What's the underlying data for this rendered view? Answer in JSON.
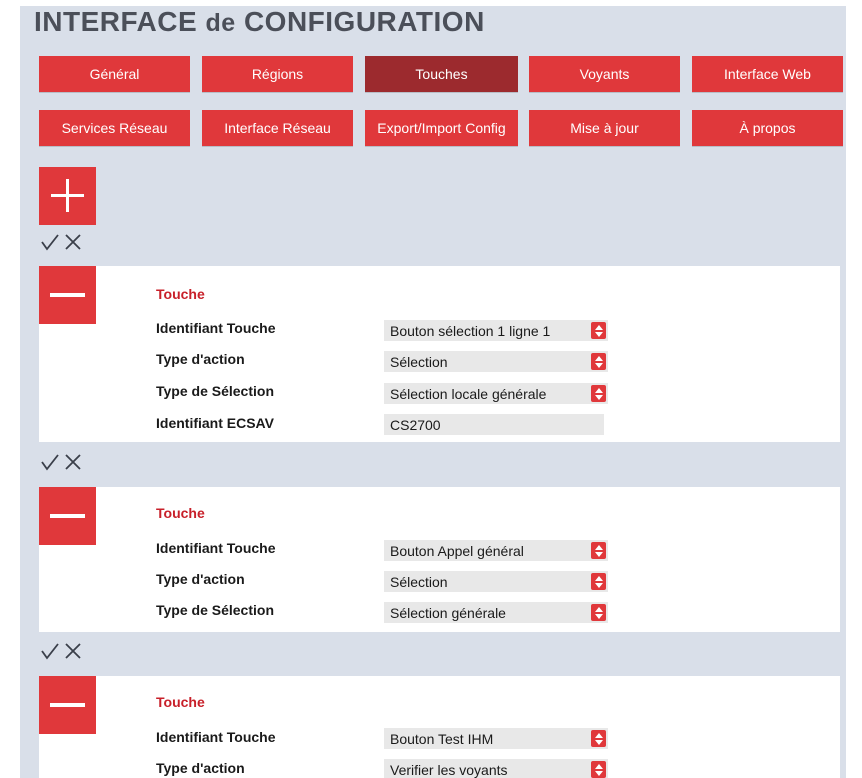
{
  "page": {
    "title_main": "INTERFACE",
    "title_de": "de",
    "title_end": "CONFIGURATION"
  },
  "nav": {
    "row1": [
      "Général",
      "Régions",
      "Touches",
      "Voyants",
      "Interface Web"
    ],
    "row2": [
      "Services Réseau",
      "Interface Réseau",
      "Export/Import Config",
      "Mise à jour",
      "À propos"
    ],
    "active": "Touches"
  },
  "colors": {
    "accent": "#e0383b",
    "accent_active": "#9c2a2e",
    "panel_bg": "#d9dfe9",
    "title_red": "#c8202a"
  },
  "icons": {
    "add": "plus-icon",
    "remove": "minus-icon",
    "confirm": "check-icon",
    "cancel": "x-icon",
    "select_arrows": "up-down-arrows-icon"
  },
  "cards": [
    {
      "title": "Touche",
      "rows": [
        {
          "label": "Identifiant Touche",
          "value": "Bouton sélection 1 ligne 1",
          "kind": "select"
        },
        {
          "label": "Type d'action",
          "value": "Sélection",
          "kind": "select"
        },
        {
          "label": "Type de Sélection",
          "value": "Sélection locale générale",
          "kind": "select"
        },
        {
          "label": "Identifiant ECSAV",
          "value": "CS2700",
          "kind": "input"
        }
      ]
    },
    {
      "title": "Touche",
      "rows": [
        {
          "label": "Identifiant Touche",
          "value": "Bouton Appel général",
          "kind": "select"
        },
        {
          "label": "Type d'action",
          "value": "Sélection",
          "kind": "select"
        },
        {
          "label": "Type de Sélection",
          "value": "Sélection générale",
          "kind": "select"
        }
      ]
    },
    {
      "title": "Touche",
      "rows": [
        {
          "label": "Identifiant Touche",
          "value": "Bouton Test IHM",
          "kind": "select"
        },
        {
          "label": "Type d'action",
          "value": "Verifier les voyants",
          "kind": "select"
        }
      ]
    }
  ]
}
